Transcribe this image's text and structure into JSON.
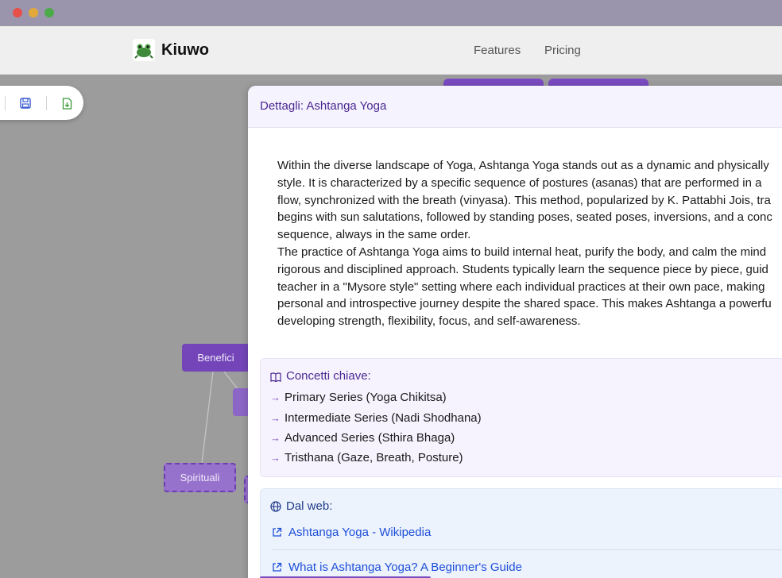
{
  "header": {
    "brand": "Kiuwo",
    "nav": [
      "Features",
      "Pricing"
    ]
  },
  "toolbar": {
    "icons": [
      "save-icon",
      "download-icon"
    ]
  },
  "canvas": {
    "nodes": {
      "benefici": "Benefici",
      "spirituali": "Spirituali"
    }
  },
  "panel": {
    "title": "Dettagli: Ashtanga Yoga",
    "body_lines": [
      "Within the diverse landscape of Yoga, Ashtanga Yoga stands out as a dynamic and physically",
      "style. It is characterized by a specific sequence of postures (asanas) that are performed in a",
      "flow, synchronized with the breath (vinyasa). This method, popularized by K. Pattabhi Jois, tra",
      "begins with sun salutations, followed by standing poses, seated poses, inversions, and a conc",
      "sequence, always in the same order.",
      "The practice of Ashtanga Yoga aims to build internal heat, purify the body, and calm the mind",
      "rigorous and disciplined approach. Students typically learn the sequence piece by piece, guid",
      "teacher in a \"Mysore style\" setting where each individual practices at their own pace, making",
      "personal and introspective journey despite the shared space. This makes Ashtanga a powerfu",
      "developing strength, flexibility, focus, and self-awareness."
    ],
    "concepts": {
      "title": "Concetti chiave:",
      "items": [
        "Primary Series (Yoga Chikitsa)",
        "Intermediate Series (Nadi Shodhana)",
        "Advanced Series (Sthira Bhaga)",
        "Tristhana (Gaze, Breath, Posture)"
      ]
    },
    "web": {
      "title": "Dal web:",
      "links": [
        "Ashtanga Yoga - Wikipedia",
        "What is Ashtanga Yoga? A Beginner's Guide"
      ]
    }
  },
  "colors": {
    "accent": "#7a4bc0",
    "title_purple": "#4a2790",
    "link_blue": "#1d4ed8"
  }
}
